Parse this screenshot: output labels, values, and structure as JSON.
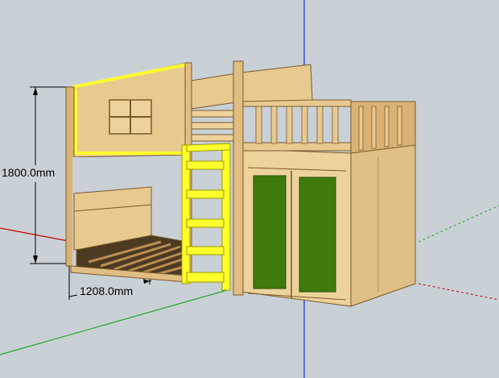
{
  "colors": {
    "background": "#c9d1d6",
    "wood_light": "#e8c98f",
    "wood_mid": "#d9b274",
    "wood_dark": "#b88e52",
    "wood_edge": "#7a5a2c",
    "highlight": "#ffff2e",
    "panel_green": "#3f7a0c",
    "slat_dark": "#4d3a22",
    "axis_red": "#cc0000",
    "axis_green": "#1fa81f",
    "axis_blue": "#1a2fcc"
  },
  "dimensions": {
    "height_label": "1800.0mm",
    "width_label": "1208.0mm"
  },
  "icons": {
    "axis_origin": "axes-origin-icon"
  }
}
